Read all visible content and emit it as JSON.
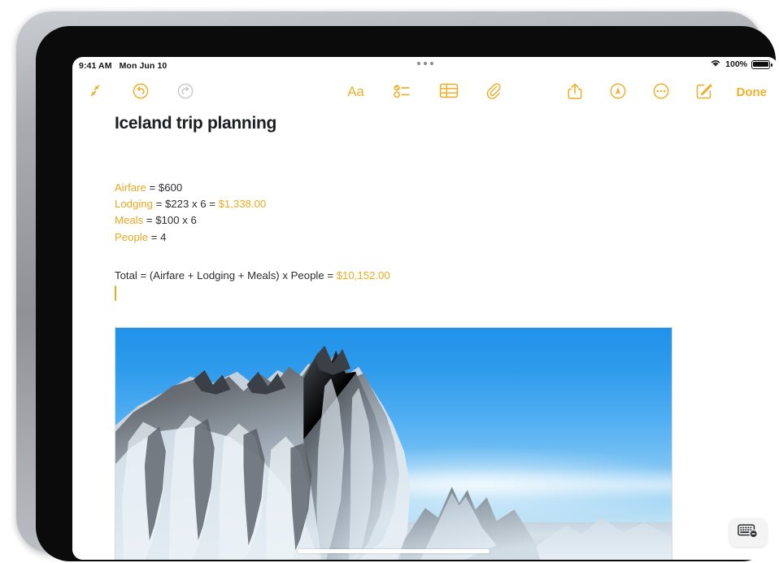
{
  "statusbar": {
    "time": "9:41 AM",
    "date": "Mon Jun 10",
    "battery_percent": "100%",
    "wifi_icon": "wifi-icon",
    "battery_icon": "battery-full-icon",
    "multitask_icon": "multitasking-dots-icon"
  },
  "toolbar": {
    "left": [
      {
        "name": "collapse-button",
        "icon": "arrows-collapse-icon",
        "enabled": true
      },
      {
        "name": "undo-button",
        "icon": "undo-circle-arrow-icon",
        "enabled": true
      },
      {
        "name": "redo-button",
        "icon": "redo-circle-arrow-icon",
        "enabled": false
      }
    ],
    "center": [
      {
        "name": "format-button",
        "icon": "aa-format-icon",
        "label": "Aa"
      },
      {
        "name": "checklist-button",
        "icon": "checklist-icon"
      },
      {
        "name": "table-button",
        "icon": "table-icon"
      },
      {
        "name": "attachment-button",
        "icon": "paperclip-icon"
      }
    ],
    "right": [
      {
        "name": "share-button",
        "icon": "share-up-arrow-icon"
      },
      {
        "name": "markup-button",
        "icon": "markup-pen-circle-icon"
      },
      {
        "name": "more-button",
        "icon": "ellipsis-circle-icon"
      },
      {
        "name": "compose-button",
        "icon": "compose-pencil-square-icon"
      }
    ],
    "done_label": "Done"
  },
  "note": {
    "title": "Iceland trip planning",
    "lines": [
      {
        "var": "Airfare",
        "eq": " = $600",
        "result": ""
      },
      {
        "var": "Lodging",
        "eq": " = $223 x 6  = ",
        "result": "$1,338.00"
      },
      {
        "var": "Meals",
        "eq": " = $100 x 6",
        "result": ""
      },
      {
        "var": "People",
        "eq": " = 4",
        "result": ""
      }
    ],
    "total": {
      "expression": "Total = (Airfare + Lodging + Meals)  x People  = ",
      "result": "$10,152.00"
    },
    "attachment": {
      "name": "photo-attachment",
      "description": "Snow-covered jagged mountain range under a clear blue sky"
    }
  },
  "keyboard_dismiss": {
    "name": "keyboard-dismiss-button",
    "icon": "keyboard-dismiss-icon"
  },
  "colors": {
    "accent_gold": "#ecb02a",
    "variable_gold": "#e8a820",
    "result_gold": "#eeab1e",
    "disabled_gray": "#c8cace",
    "text_dark": "#2c2d30",
    "sky_blue": "#4aa8ef"
  }
}
